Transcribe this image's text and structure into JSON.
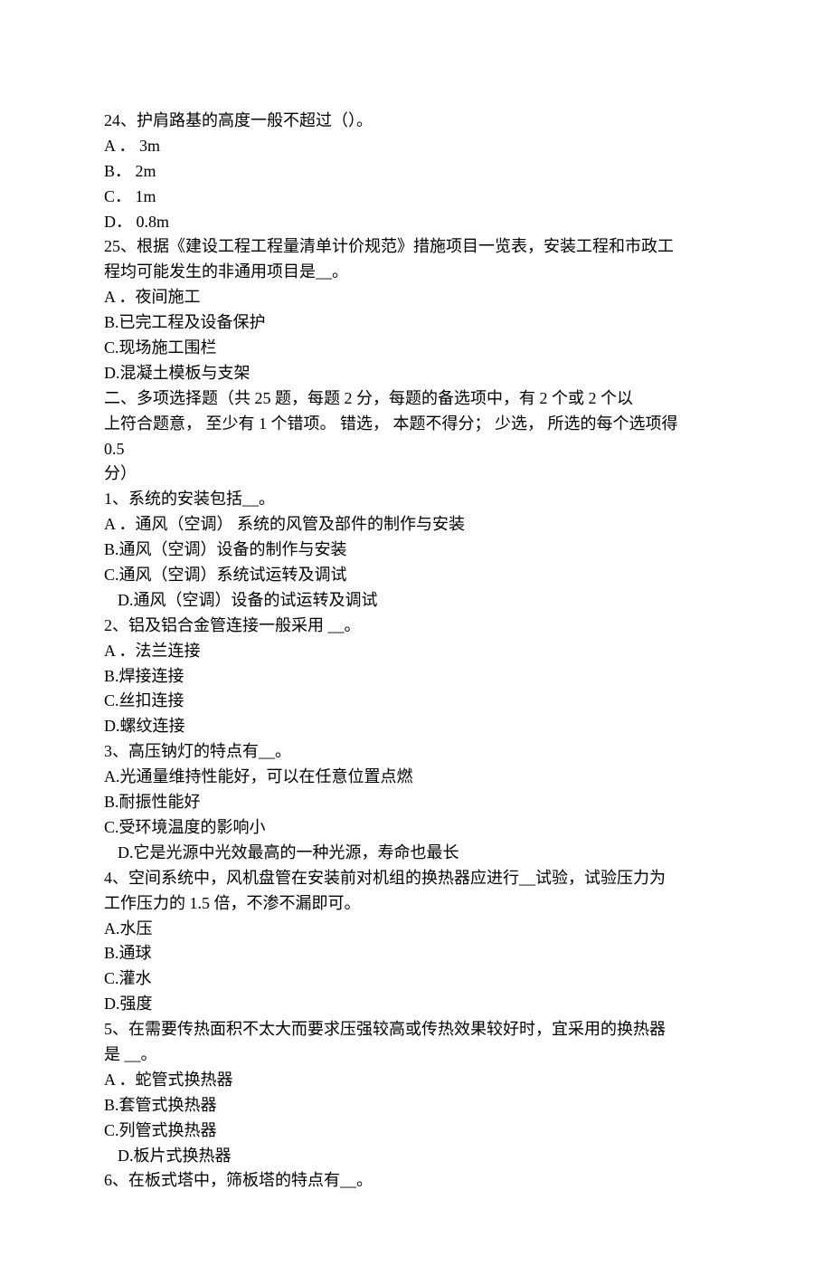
{
  "q24": {
    "stem": "24、护肩路基的高度一般不超过（）。",
    "A": "A ． 3m",
    "B": "B． 2m",
    "C": "C． 1m",
    "D": "D． 0.8m"
  },
  "q25": {
    "stem1": "25、根据《建设工程工程量清单计价规范》措施项目一览表，安装工程和市政工",
    "stem2": "程均可能发生的非通用项目是__。",
    "A": "A ．夜间施工",
    "B": "B.已完工程及设备保护",
    "C": "C.现场施工围栏",
    "D": "D.混凝土模板与支架"
  },
  "section2": {
    "l1": "二、多项选择题（共 25 题，每题 2 分，每题的备选项中，有 2 个或  2 个以",
    "l2": "上符合题意， 至少有  1 个错项。 错选， 本题不得分； 少选， 所选的每个选项得",
    "l3": "0.5",
    "l4": "分）"
  },
  "m1": {
    "stem": "1、系统的安装包括__。",
    "A": "A ．通风（空调） 系统的风管及部件的制作与安装",
    "B": "B.通风（空调）设备的制作与安装",
    "C": "C.通风（空调）系统试运转及调试",
    "D": "D.通风（空调）设备的试运转及调试"
  },
  "m2": {
    "stem": "2、铝及铝合金管连接一般采用  __。",
    "A": "A ．法兰连接",
    "B": "B.焊接连接",
    "C": "C.丝扣连接",
    "D": "D.螺纹连接"
  },
  "m3": {
    "stem": "3、高压钠灯的特点有__。",
    "A": "A.光通量维持性能好，可以在任意位置点燃",
    "B": "B.耐振性能好",
    "C": "C.受环境温度的影响小",
    "D": "D.它是光源中光效最高的一种光源，寿命也最长"
  },
  "m4": {
    "stem1": "4、空间系统中，风机盘管在安装前对机组的换热器应进行__试验，试验压力为",
    "stem2": "工作压力的  1.5 倍，不渗不漏即可。",
    "A": "A.水压",
    "B": "B.通球",
    "C": "C.灌水",
    "D": "D.强度"
  },
  "m5": {
    "stem1": "5、在需要传热面积不太大而要求压强较高或传热效果较好时，宜采用的换热器",
    "stem2": "是  __。",
    "A": "A ．蛇管式换热器",
    "B": "B.套管式换热器",
    "C": "C.列管式换热器",
    "D": "D.板片式换热器"
  },
  "m6": {
    "stem": "6、在板式塔中，筛板塔的特点有__。"
  }
}
